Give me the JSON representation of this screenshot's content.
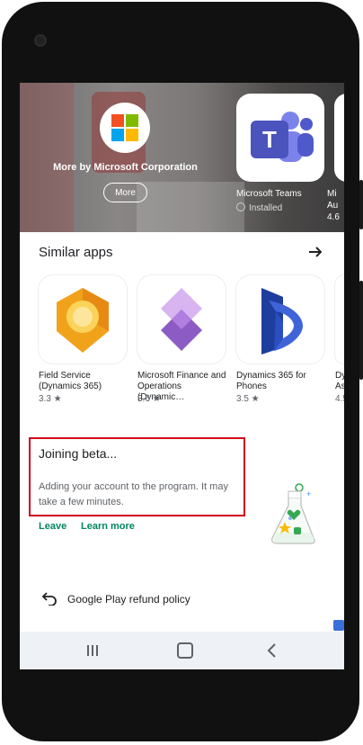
{
  "hero": {
    "developer_title": "More by Microsoft Corporation",
    "more_button": "More",
    "featured_app": {
      "name": "Microsoft Teams",
      "status": "Installed"
    },
    "next_app": {
      "name_line1": "Mi",
      "name_line2": "Au",
      "rating": "4.6"
    }
  },
  "similar_apps": {
    "title": "Similar apps",
    "apps": [
      {
        "name": "Field Service (Dynamics 365)",
        "rating": "3.3 ★"
      },
      {
        "name": "Microsoft Finance and Operations (Dynamic…",
        "rating": "3.6 ★"
      },
      {
        "name": "Dynamics 365 for Phones",
        "rating": "3.5 ★"
      },
      {
        "name": "Dy As",
        "rating": "4.5"
      }
    ]
  },
  "beta": {
    "title": "Joining beta...",
    "description": "Adding your account to the program. It may take a few minutes.",
    "leave_link": "Leave",
    "learn_more_link": "Learn more"
  },
  "refund": {
    "label": "Google Play refund policy"
  },
  "colors": {
    "accent_green": "#01875f",
    "highlight_red": "#d0021b"
  }
}
